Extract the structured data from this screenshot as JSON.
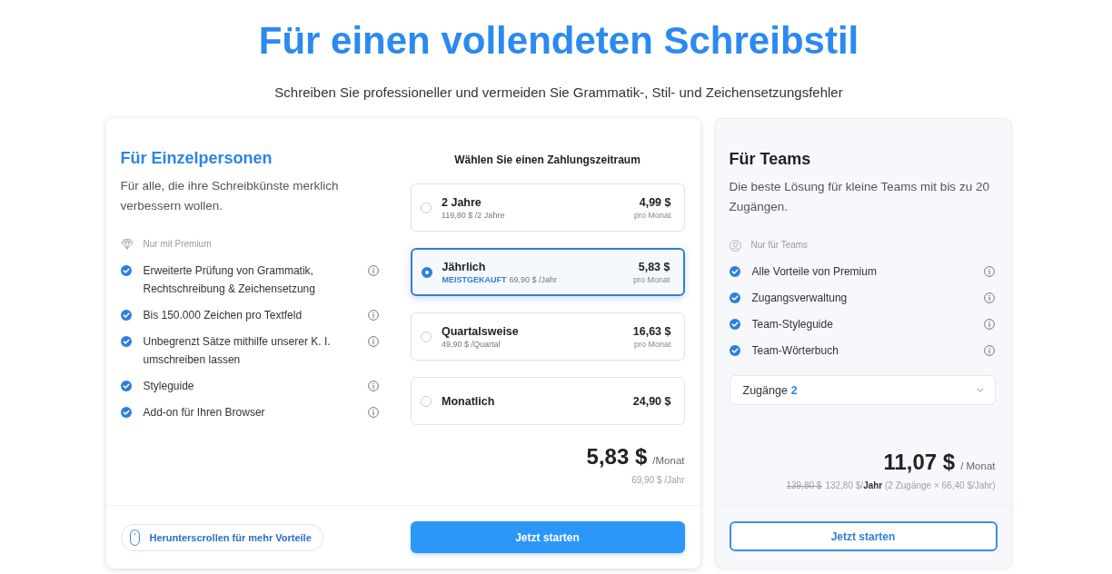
{
  "header": {
    "title": "Für einen vollendeten Schreibstil",
    "subtitle": "Schreiben Sie professioneller und vermeiden Sie Grammatik-, Stil- und Zeichensetzungsfehler"
  },
  "individual": {
    "title": "Für Einzelpersonen",
    "description": "Für alle, die ihre Schreibkünste merklich verbessern wollen.",
    "group_label": "Nur mit Premium",
    "features": [
      "Erweiterte Prüfung von Grammatik, Rechtschreibung & Zeichensetzung",
      "Bis 150.000 Zeichen pro Textfeld",
      "Unbegrenzt Sätze mithilfe unserer K. I. umschreiben lassen",
      "Styleguide",
      "Add-on für Ihren Browser"
    ],
    "billing": {
      "heading": "Wählen Sie einen Zahlungszeitraum",
      "options": [
        {
          "name": "2 Jahre",
          "detail": "119,80 $ /2 Jahre",
          "price": "4,99 $",
          "price_note": "pro Monat",
          "selected": false
        },
        {
          "name": "Jährlich",
          "badge": "MEISTGEKAUFT",
          "detail": "69,90 $ /Jahr",
          "price": "5,83 $",
          "price_note": "pro Monat",
          "selected": true
        },
        {
          "name": "Quartalsweise",
          "detail": "49,90 $ /Quartal",
          "price": "16,63 $",
          "price_note": "pro Monat",
          "selected": false
        },
        {
          "name": "Monatlich",
          "price": "24,90 $",
          "selected": false
        }
      ],
      "total": {
        "price": "5,83 $",
        "unit": "/Monat",
        "note": "69,90 $ /Jahr"
      }
    },
    "scroll_hint": "Herunterscrollen für mehr Vorteile",
    "cta": "Jetzt starten"
  },
  "teams": {
    "title": "Für Teams",
    "description": "Die beste Lösung für kleine Teams mit bis zu 20 Zugängen.",
    "group_label": "Nur für Teams",
    "features": [
      "Alle Vorteile von Premium",
      "Zugangsverwaltung",
      "Team-Styleguide",
      "Team-Wörterbuch"
    ],
    "seats": {
      "label": "Zugänge",
      "value": "2"
    },
    "total": {
      "price": "11,07 $",
      "unit": "/ Monat",
      "old_price": "139,80 $",
      "note": "132,80 $/**Jahr** (2 Zugänge × 66,40 $/Jahr)"
    },
    "cta": "Jetzt starten"
  }
}
